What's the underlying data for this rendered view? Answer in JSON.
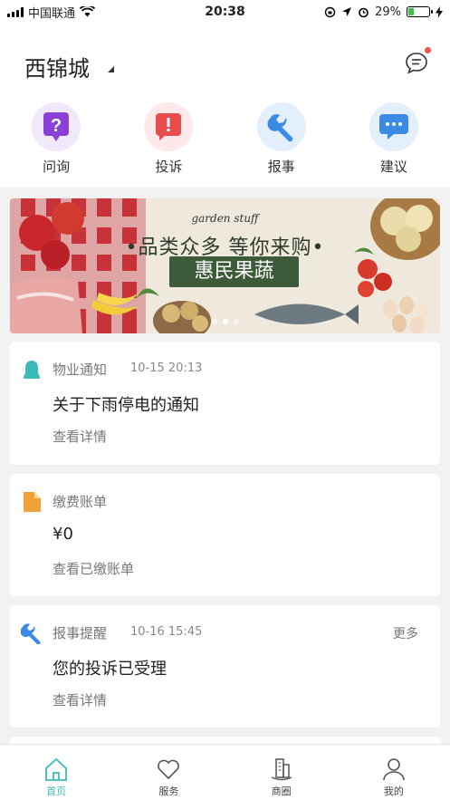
{
  "status_bar": {
    "carrier": "中国联通",
    "time": "20:38",
    "battery": "29%",
    "battery_fraction": 0.29,
    "icons": [
      "signal-icon",
      "wifi-icon",
      "orientation-lock-icon",
      "location-icon",
      "alarm-icon",
      "battery-icon",
      "charging-icon"
    ]
  },
  "header": {
    "city": "西锦城",
    "message_icon": "chat-bubble-icon"
  },
  "quick_actions": [
    {
      "label": "问询",
      "icon": "question-icon",
      "color": "#8a3fd6",
      "bg": "#f1e8fa"
    },
    {
      "label": "投诉",
      "icon": "alert-icon",
      "color": "#e84c4c",
      "bg": "#fde9e9"
    },
    {
      "label": "报事",
      "icon": "wrench-icon",
      "color": "#3b8be6",
      "bg": "#e3f0fc"
    },
    {
      "label": "建议",
      "icon": "speech-bubble-icon",
      "color": "#3b8be6",
      "bg": "#e3f0fc"
    }
  ],
  "banner": {
    "subtitle": "garden stuff",
    "headline": "•品类众多 等你来购•",
    "tag": "惠民果蔬",
    "page_count": 3,
    "active_page": 2
  },
  "cards": [
    {
      "title": "物业通知",
      "time": "10-15 20:13",
      "body": "关于下雨停电的通知",
      "link": "查看详情",
      "icon": "bell-icon",
      "icon_color": "#3dbcb7"
    },
    {
      "title": "缴费账单",
      "body": "¥0",
      "link": "查看已缴账单",
      "icon": "document-icon",
      "icon_color": "#f0a238"
    },
    {
      "title": "报事提醒",
      "time": "10-16 15:45",
      "more": "更多",
      "body": "您的投诉已受理",
      "link": "查看详情",
      "icon": "wrench-icon",
      "icon_color": "#3b8be6"
    }
  ],
  "tabs": [
    {
      "label": "首页",
      "icon": "home-icon",
      "active": true
    },
    {
      "label": "服务",
      "icon": "heart-icon",
      "active": false
    },
    {
      "label": "商圈",
      "icon": "building-icon",
      "active": false
    },
    {
      "label": "我的",
      "icon": "user-icon",
      "active": false
    }
  ],
  "colors": {
    "accent": "#3dbcb7",
    "background": "#f2f2f2",
    "notification_dot": "#f4534a",
    "banner_tag": "#3d5b3a"
  }
}
